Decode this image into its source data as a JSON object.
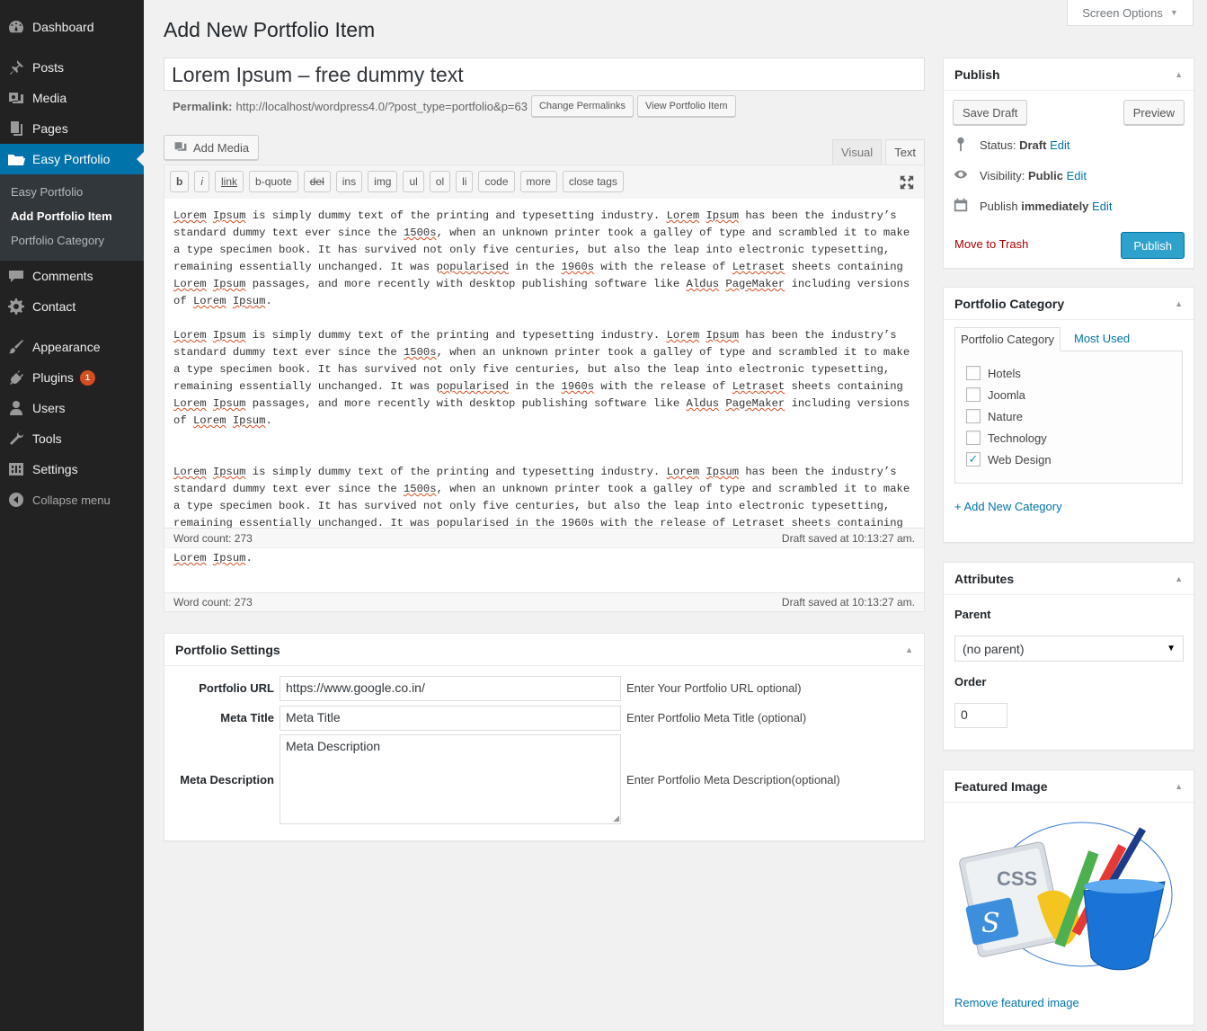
{
  "sidebar": {
    "items": [
      {
        "label": "Dashboard",
        "icon": "dashboard-icon"
      },
      {
        "label": "Posts",
        "icon": "pin-icon"
      },
      {
        "label": "Media",
        "icon": "media-icon"
      },
      {
        "label": "Pages",
        "icon": "pages-icon"
      },
      {
        "label": "Easy Portfolio",
        "icon": "folder-icon"
      },
      {
        "label": "Comments",
        "icon": "comment-icon"
      },
      {
        "label": "Contact",
        "icon": "gear-icon"
      },
      {
        "label": "Appearance",
        "icon": "brush-icon"
      },
      {
        "label": "Plugins",
        "icon": "plugin-icon",
        "badge": "1"
      },
      {
        "label": "Users",
        "icon": "user-icon"
      },
      {
        "label": "Tools",
        "icon": "wrench-icon"
      },
      {
        "label": "Settings",
        "icon": "settings-icon"
      },
      {
        "label": "Collapse menu",
        "icon": "collapse-icon"
      }
    ],
    "submenu": [
      "Easy Portfolio",
      "Add Portfolio Item",
      "Portfolio Category"
    ]
  },
  "screen_options": "Screen Options",
  "page_title": "Add New Portfolio Item",
  "post_title": "Lorem Ipsum – free dummy text",
  "permalink": {
    "label": "Permalink:",
    "url": "http://localhost/wordpress4.0/?post_type=portfolio&p=63",
    "change_button": "Change Permalinks",
    "view_button": "View Portfolio Item"
  },
  "editor": {
    "add_media": "Add Media",
    "tab_visual": "Visual",
    "tab_text": "Text",
    "quicktags": [
      "b",
      "i",
      "link",
      "b-quote",
      "del",
      "ins",
      "img",
      "ul",
      "ol",
      "li",
      "code",
      "more",
      "close tags"
    ],
    "paragraph": {
      "w1": "Lorem",
      "w2": "Ipsum",
      "t1": " is simply dummy text of the printing and typesetting industry. ",
      "t2": " has been the industry’s standard dummy text ever since the ",
      "w3": "1500s",
      "t3": ", when an unknown printer took a galley of type and scrambled it to make a type specimen book. It has survived not only five centuries, but also the leap into electronic typesetting, remaining essentially unchanged. It was ",
      "w4": "popularised",
      "t4": " in the ",
      "w5": "1960s",
      "t5": " with the release of ",
      "w6": "Letraset",
      "t6": " sheets containing ",
      "t7": " passages, and more recently with desktop publishing software like ",
      "w7": "Aldus",
      "w8": "PageMaker",
      "t8": " including versions of ",
      "end": "."
    },
    "word_count": "Word count: 273",
    "draft_saved": "Draft saved at 10:13:27 am."
  },
  "portfolio_settings": {
    "title": "Portfolio Settings",
    "url_label": "Portfolio URL",
    "url_value": "https://www.google.co.in/",
    "url_hint": "Enter Your Portfolio URL optional)",
    "meta_title_label": "Meta Title",
    "meta_title_value": "Meta Title",
    "meta_title_hint": "Enter Portfolio Meta Title (optional)",
    "meta_desc_label": "Meta Description",
    "meta_desc_value": "Meta Description",
    "meta_desc_hint": "Enter Portfolio Meta Description(optional)"
  },
  "publish": {
    "title": "Publish",
    "save_draft": "Save Draft",
    "preview": "Preview",
    "status_label": "Status:",
    "status_value": "Draft",
    "visibility_label": "Visibility:",
    "visibility_value": "Public",
    "publish_label": "Publish",
    "publish_value": "immediately",
    "edit": "Edit",
    "trash": "Move to Trash",
    "publish_button": "Publish"
  },
  "category": {
    "title": "Portfolio Category",
    "tab_all": "Portfolio Category",
    "tab_most_used": "Most Used",
    "items": [
      {
        "label": "Hotels",
        "checked": false
      },
      {
        "label": "Joomla",
        "checked": false
      },
      {
        "label": "Nature",
        "checked": false
      },
      {
        "label": "Technology",
        "checked": false
      },
      {
        "label": "Web Design",
        "checked": true
      }
    ],
    "add_new": "+ Add New Category"
  },
  "attributes": {
    "title": "Attributes",
    "parent_label": "Parent",
    "parent_value": "(no parent)",
    "order_label": "Order",
    "order_value": "0"
  },
  "featured_image": {
    "title": "Featured Image",
    "image_text": "CSS",
    "remove": "Remove featured image"
  },
  "colors": {
    "sidebar_bg": "#222222",
    "accent": "#0073aa",
    "primary_button": "#2ea2cc",
    "trash": "#a00000",
    "badge": "#d54e21"
  }
}
